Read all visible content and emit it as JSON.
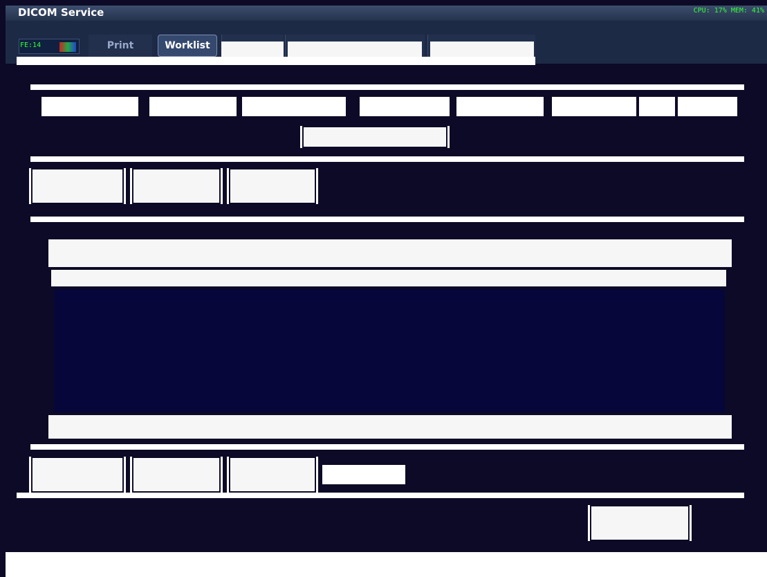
{
  "window": {
    "title": "DICOM Service",
    "system_monitor": "CPU: 17%  MEM: 41%"
  },
  "header": {
    "fe_indicator": "FE:14"
  },
  "tabs": [
    {
      "label": "Print",
      "active": false
    },
    {
      "label": "Worklist",
      "active": true
    }
  ],
  "colors": {
    "background": "#0c0a26",
    "title_bar": "#3c4e6e",
    "monitor_text": "#33ff33",
    "panel": "#f6f6f6"
  }
}
